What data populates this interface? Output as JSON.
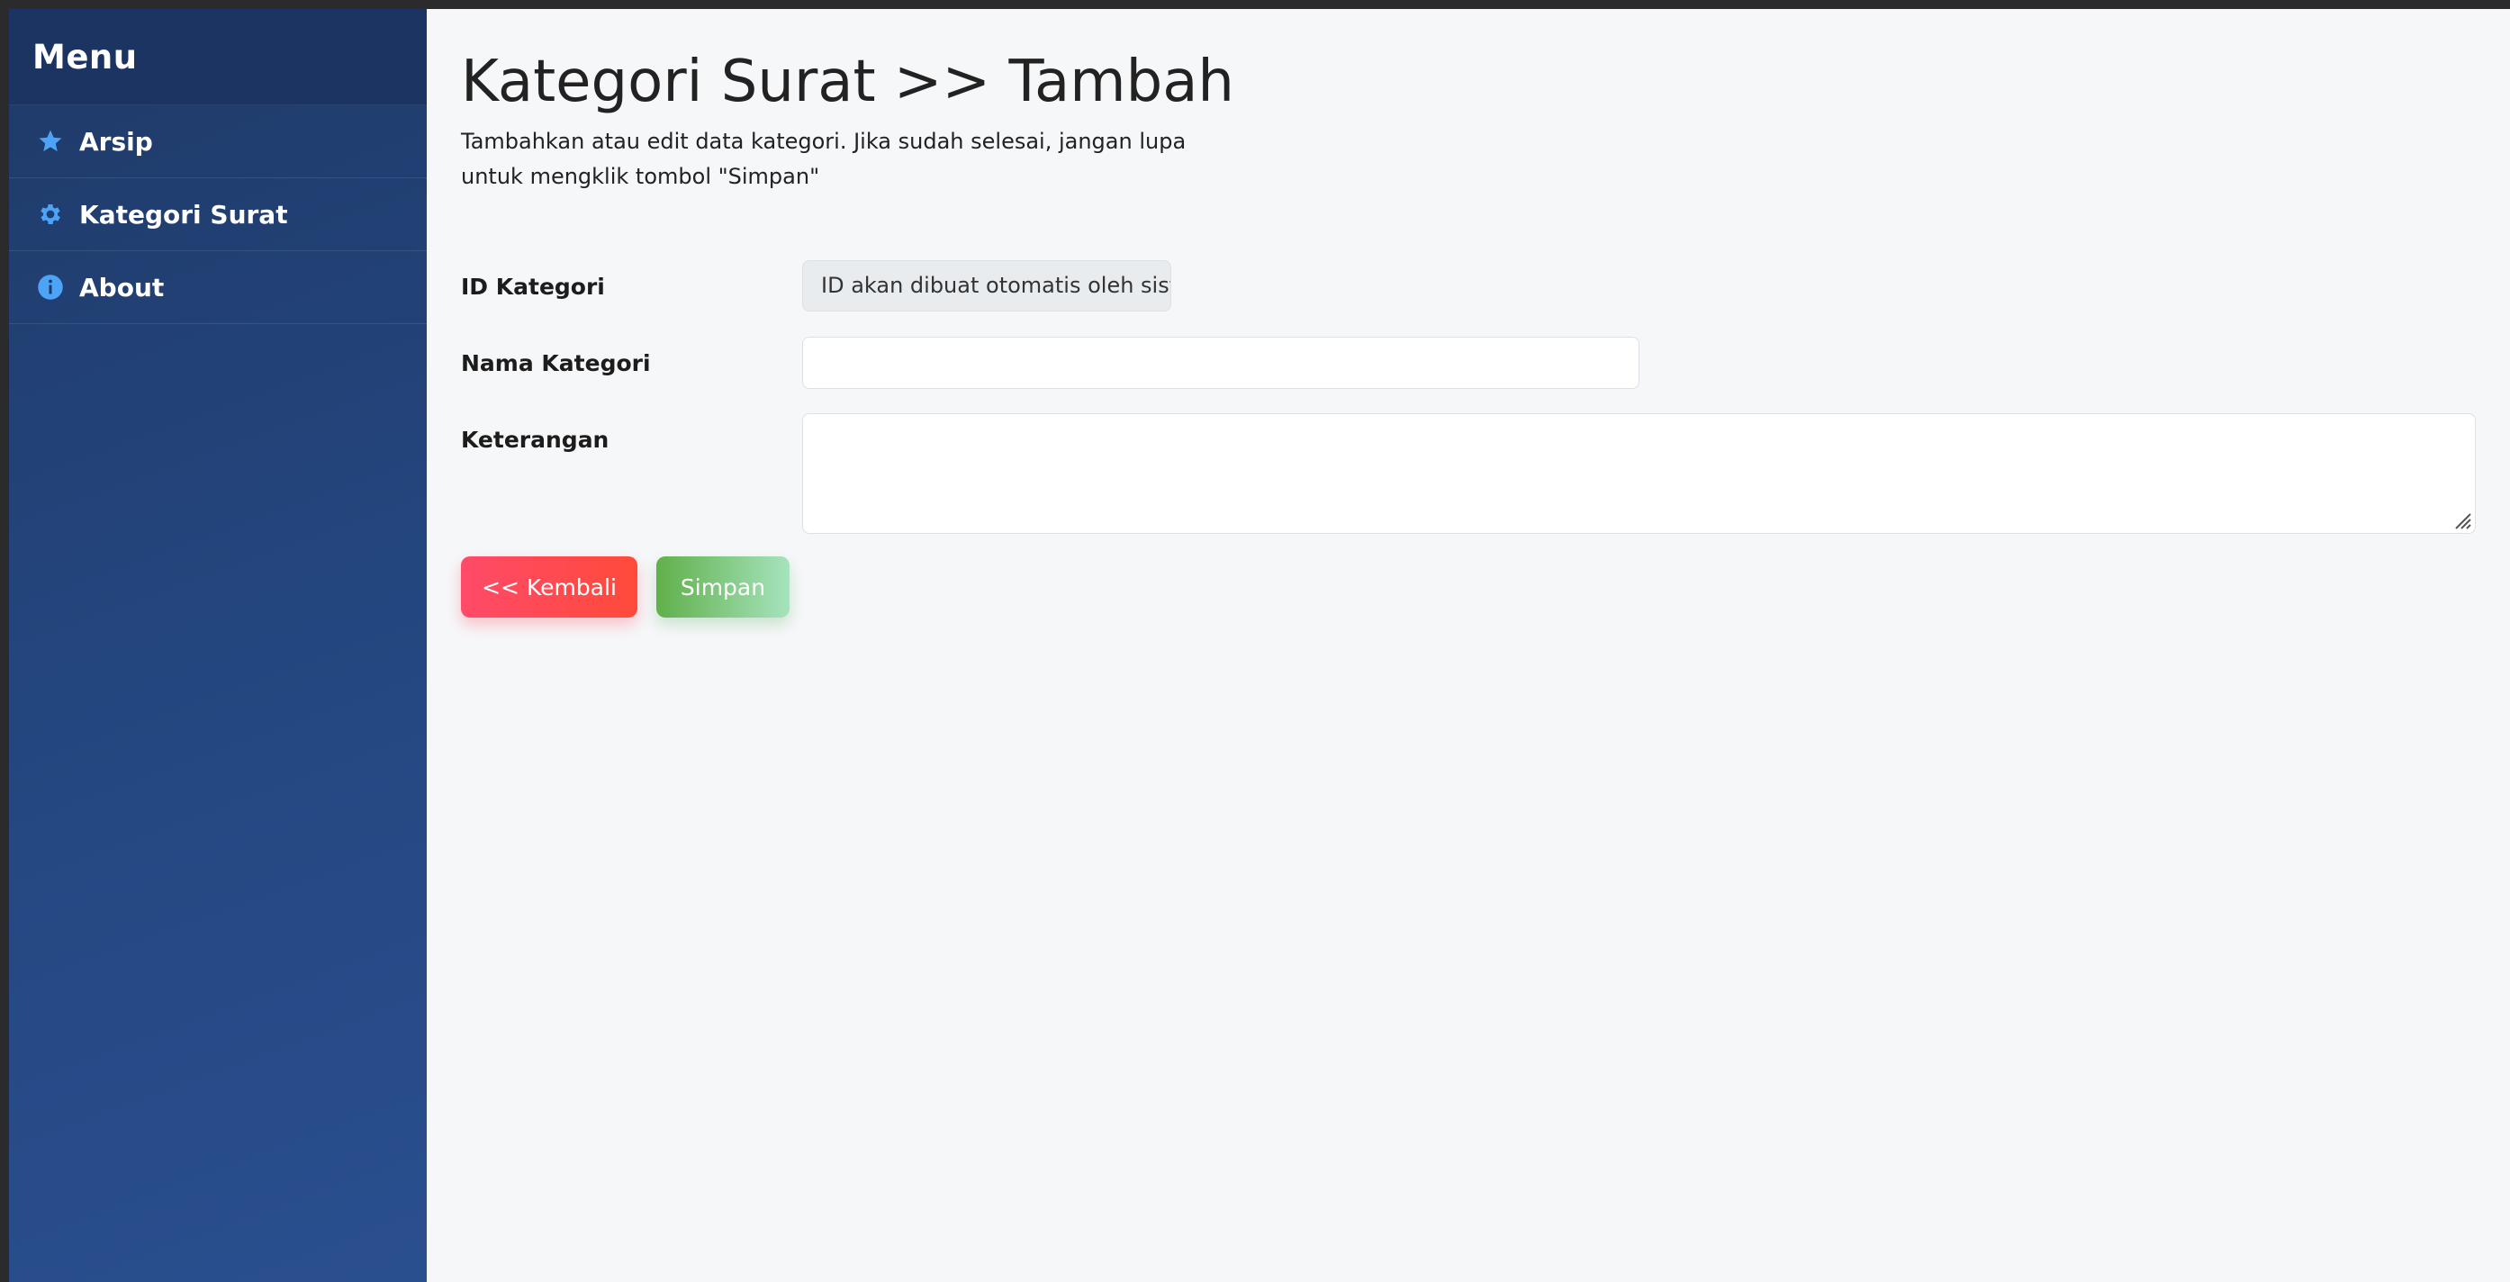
{
  "sidebar": {
    "title": "Menu",
    "items": [
      {
        "label": "Arsip",
        "icon": "star-icon"
      },
      {
        "label": "Kategori Surat",
        "icon": "gear-icon"
      },
      {
        "label": "About",
        "icon": "info-icon"
      }
    ]
  },
  "main": {
    "title": "Kategori Surat >> Tambah",
    "description": "Tambahkan atau edit data kategori. Jika sudah selesai, jangan lupa untuk mengklik tombol \"Simpan\"",
    "form": {
      "id_label": "ID Kategori",
      "id_value": "ID akan dibuat otomatis oleh sistem",
      "name_label": "Nama Kategori",
      "name_value": "",
      "desc_label": "Keterangan",
      "desc_value": ""
    },
    "buttons": {
      "back_label": "<< Kembali",
      "save_label": "Simpan"
    }
  },
  "colors": {
    "sidebar_bg": "#24467f",
    "icon_accent": "#4da3f5",
    "back_button": "#ff4a5a",
    "save_button": "#6bbf57"
  }
}
